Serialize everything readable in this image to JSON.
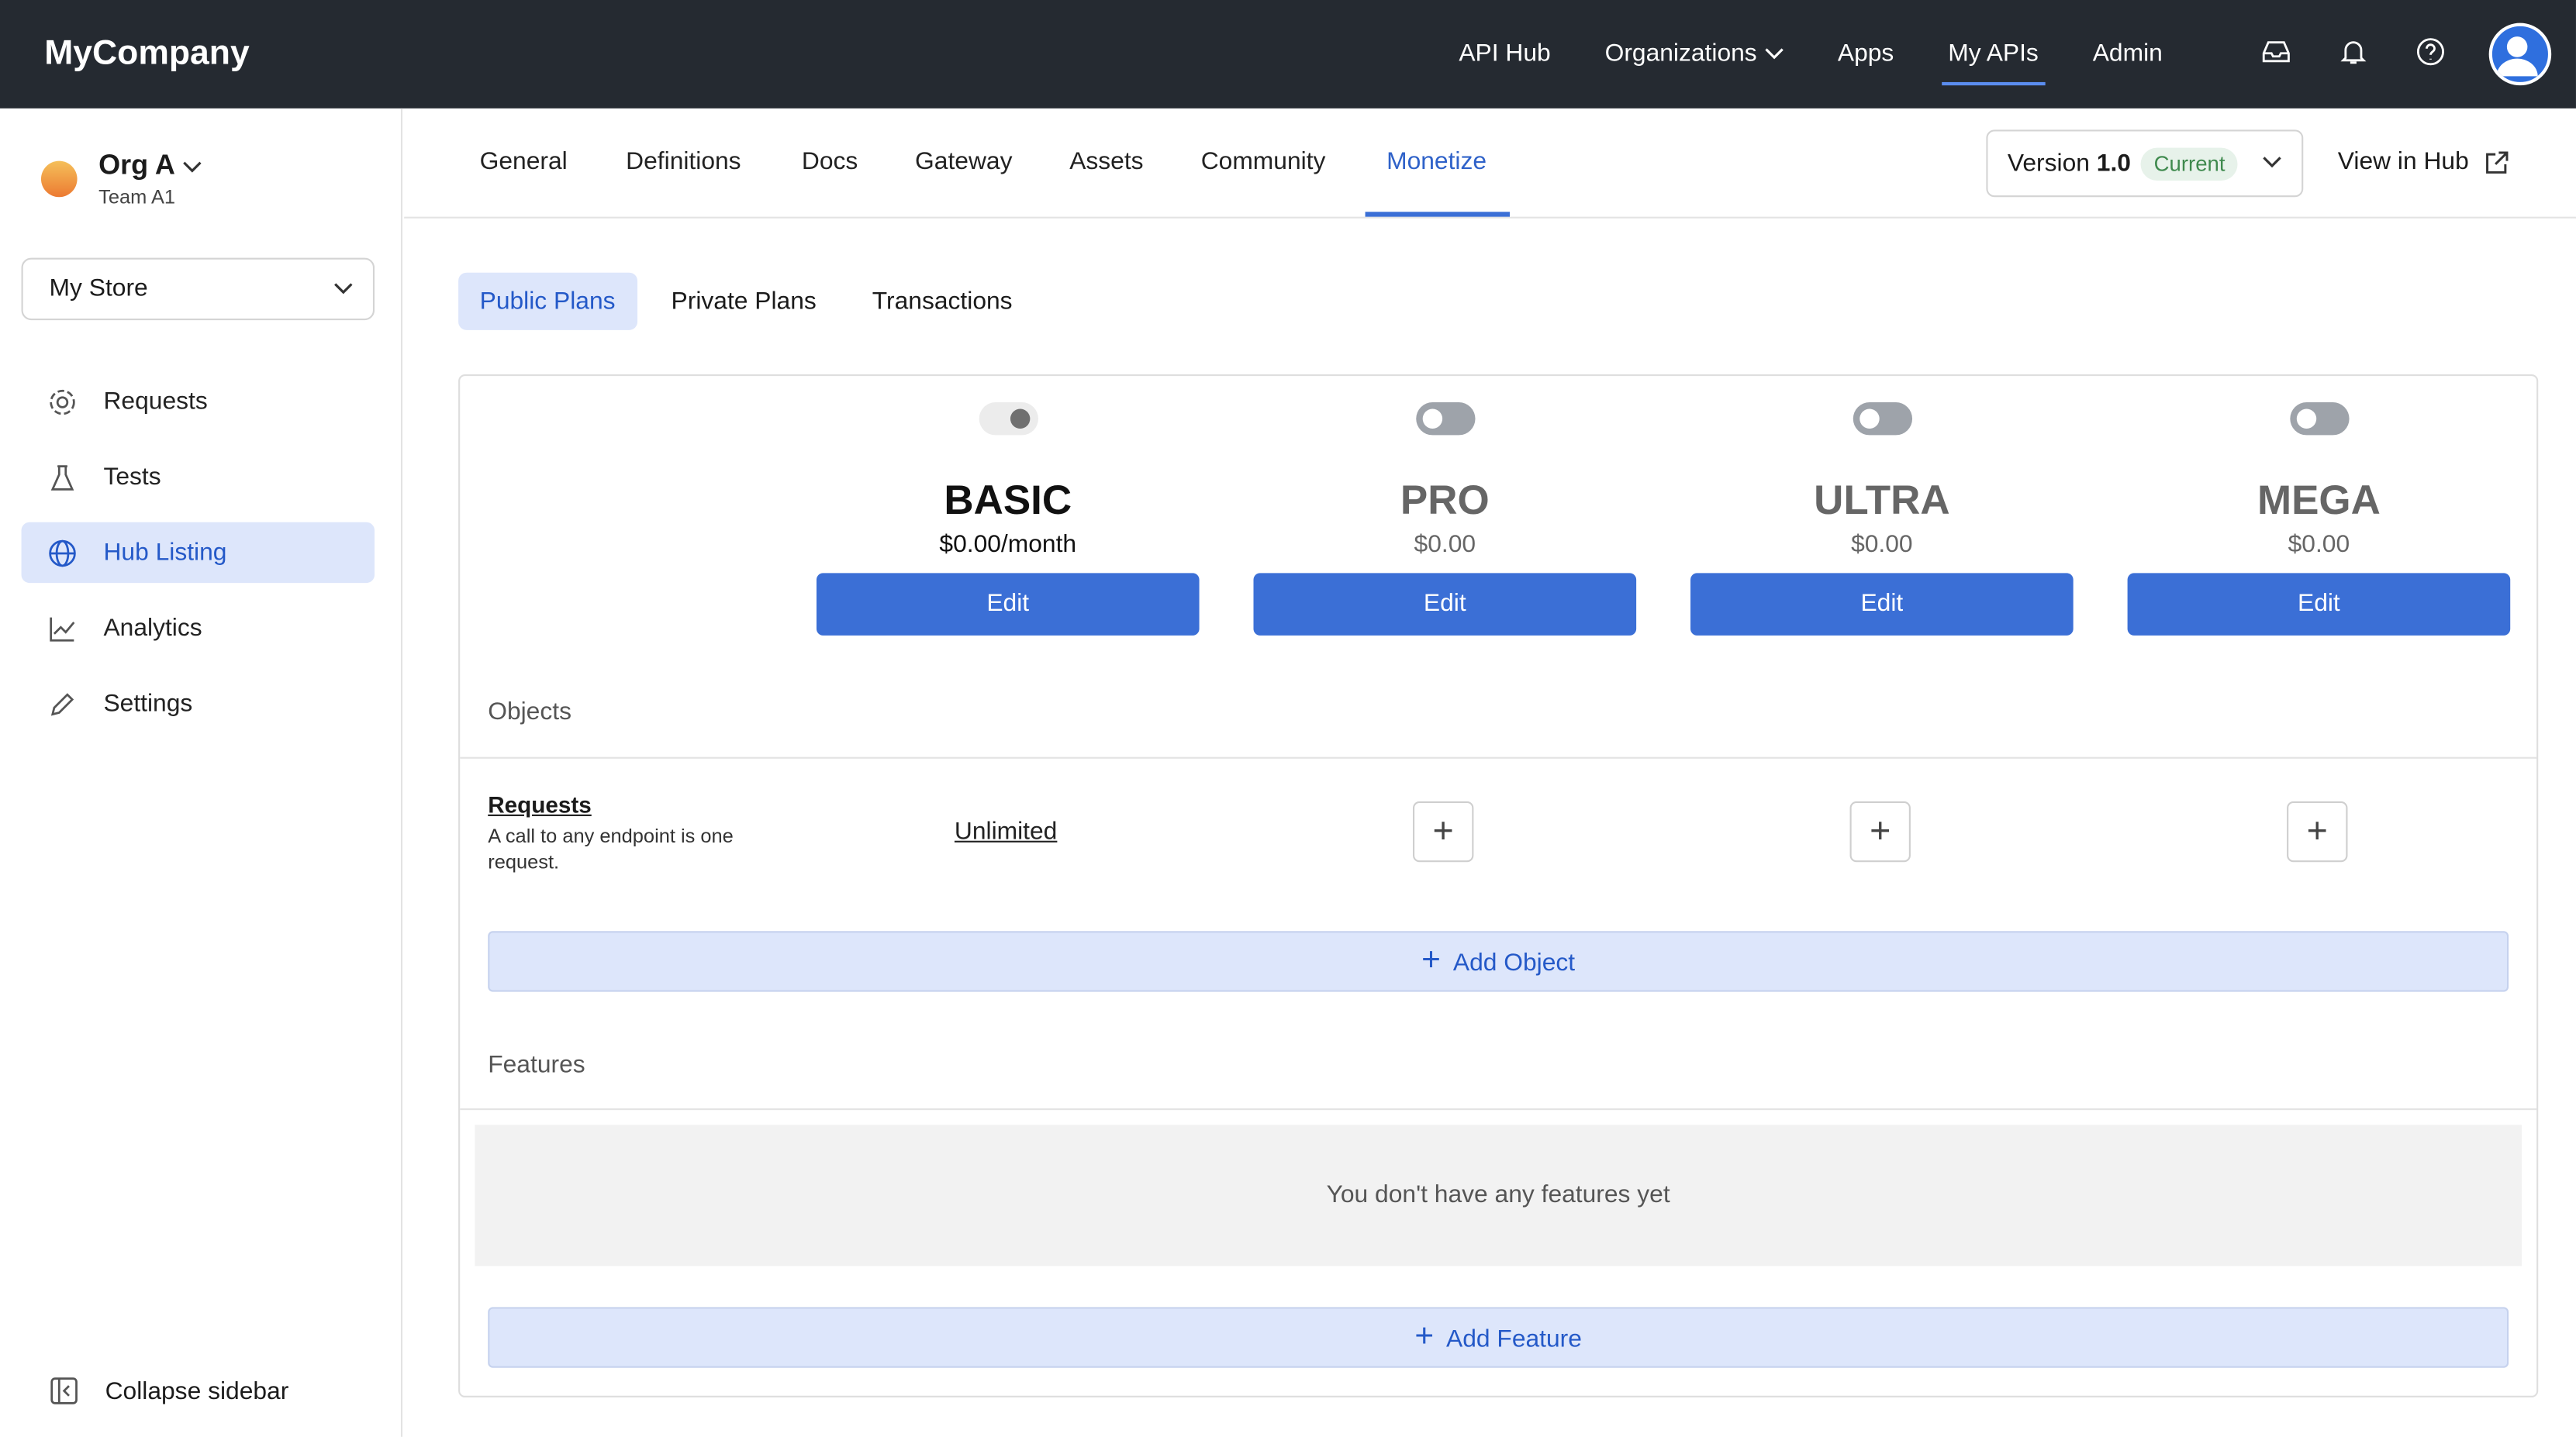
{
  "header": {
    "logo": "MyCompany",
    "nav": [
      "API Hub",
      "Organizations",
      "Apps",
      "My APIs",
      "Admin"
    ],
    "active": "My APIs",
    "icons": [
      "inbox-icon",
      "bell-icon",
      "help-icon",
      "avatar"
    ]
  },
  "sidebar": {
    "org": "Org A",
    "team": "Team A1",
    "store": "My Store",
    "items": [
      {
        "label": "Requests",
        "icon": "requests-icon"
      },
      {
        "label": "Tests",
        "icon": "flask-icon"
      },
      {
        "label": "Hub Listing",
        "icon": "globe-icon"
      },
      {
        "label": "Analytics",
        "icon": "chart-icon"
      },
      {
        "label": "Settings",
        "icon": "pencil-icon"
      }
    ],
    "active": "Hub Listing",
    "collapse": "Collapse sidebar"
  },
  "tabs": {
    "items": [
      "General",
      "Definitions",
      "Docs",
      "Gateway",
      "Assets",
      "Community",
      "Monetize"
    ],
    "active": "Monetize",
    "version_label": "Version",
    "version": "1.0",
    "version_badge": "Current",
    "view_in_hub": "View in Hub"
  },
  "subtabs": {
    "items": [
      "Public Plans",
      "Private Plans",
      "Transactions"
    ],
    "active": "Public Plans"
  },
  "plans": [
    {
      "name": "BASIC",
      "price": "$0.00/month",
      "enabled": true,
      "edit": "Edit"
    },
    {
      "name": "PRO",
      "price": "$0.00",
      "enabled": false,
      "edit": "Edit"
    },
    {
      "name": "ULTRA",
      "price": "$0.00",
      "enabled": false,
      "edit": "Edit"
    },
    {
      "name": "MEGA",
      "price": "$0.00",
      "enabled": false,
      "edit": "Edit"
    }
  ],
  "objects": {
    "heading": "Objects",
    "rows": [
      {
        "name": "Requests",
        "description": "A call to any endpoint is one request.",
        "basic": "Unlimited"
      }
    ],
    "add": "Add Object"
  },
  "features": {
    "heading": "Features",
    "empty": "You don't have any features yet",
    "add": "Add Feature"
  },
  "colors": {
    "accent": "#3b6fd6",
    "topbar": "#252a31"
  }
}
